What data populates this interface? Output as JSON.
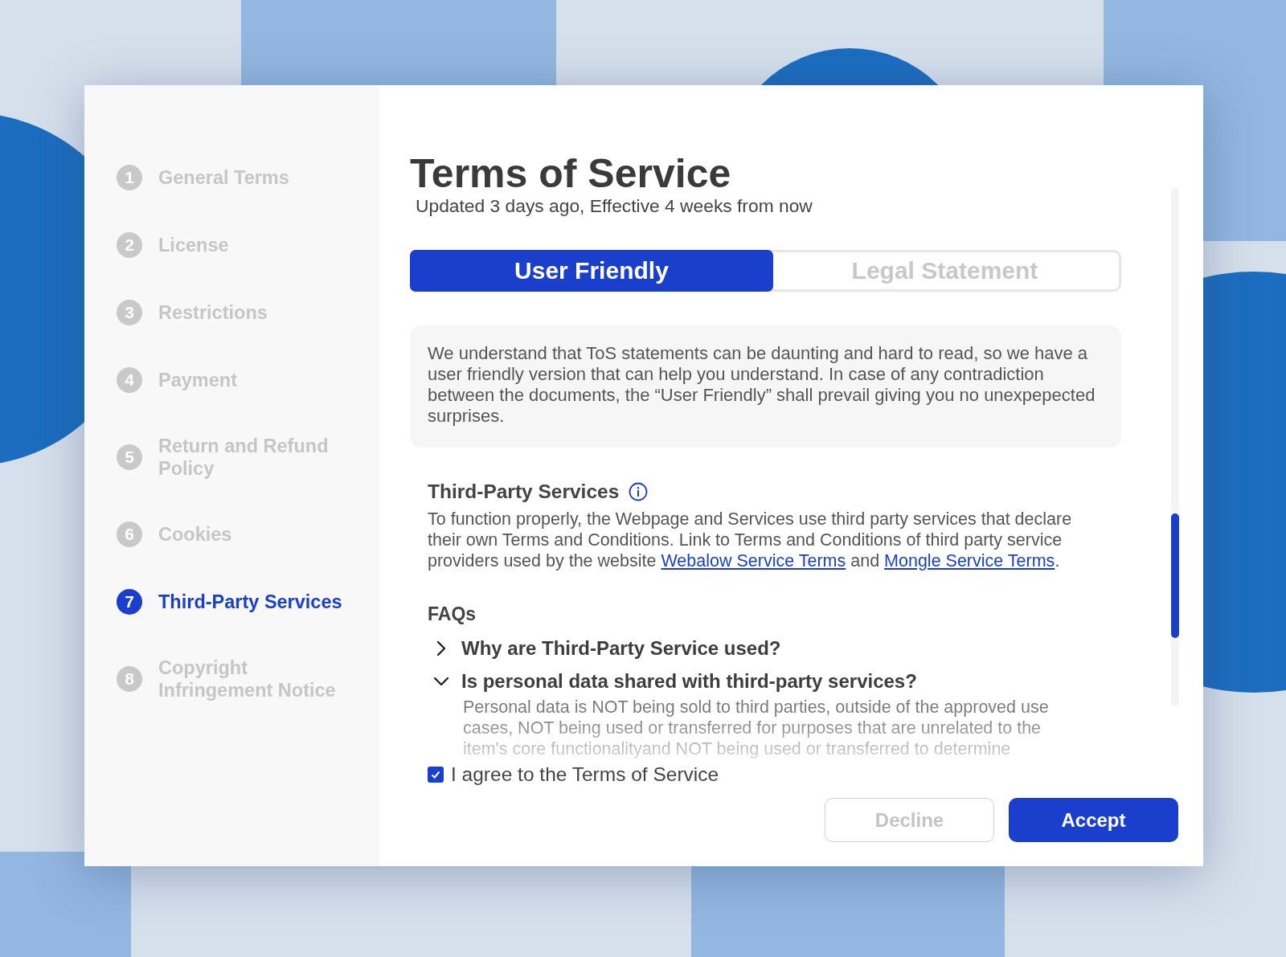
{
  "sidebar": {
    "items": [
      {
        "number": "1",
        "label": "General Terms",
        "selected": false
      },
      {
        "number": "2",
        "label": "License",
        "selected": false
      },
      {
        "number": "3",
        "label": "Restrictions",
        "selected": false
      },
      {
        "number": "4",
        "label": "Payment",
        "selected": false
      },
      {
        "number": "5",
        "label": "Return and Refund Policy",
        "selected": false
      },
      {
        "number": "6",
        "label": "Cookies",
        "selected": false
      },
      {
        "number": "7",
        "label": "Third-Party Services",
        "selected": true
      },
      {
        "number": "8",
        "label": "Copyright Infringement Notice",
        "selected": false
      }
    ]
  },
  "title": "Terms of Service",
  "subtitle": "Updated 3 days ago, Effective 4 weeks from now",
  "tabs": [
    {
      "label": "User Friendly",
      "selected": true
    },
    {
      "label": "Legal Statement",
      "selected": false
    }
  ],
  "notice": "We understand that ToS statements can be daunting and hard to read, so we have a user friendly version that can help you understand. In case of any contradiction between the documents, the “User Friendly” shall prevail giving you no unexpepected surprises.",
  "section": {
    "heading": "Third-Party Services",
    "body": [
      {
        "kind": "text",
        "text": "To function properly, the Webpage and Services use third party services that declare their own Terms and Conditions. Link to Terms and Conditions of third party service providers used by the website "
      },
      {
        "kind": "link",
        "text": "Webalow Service Terms"
      },
      {
        "kind": "text",
        "text": " and "
      },
      {
        "kind": "link",
        "text": "Mongle Service Terms"
      },
      {
        "kind": "text",
        "text": "."
      }
    ]
  },
  "faqs": {
    "heading": "FAQs",
    "items": [
      {
        "question": "Why are Third-Party Service used?",
        "expanded": false
      },
      {
        "question": "Is personal data shared with third-party services?",
        "expanded": true,
        "answer": "Personal data is NOT being sold to third parties, outside of the approved use cases, NOT being used or transferred for purposes that are unrelated to the item's core functionalityand NOT being used or transferred to determine"
      }
    ]
  },
  "agree": {
    "label": "I agree to the Terms of Service",
    "checked": true
  },
  "buttons": [
    {
      "label": "Decline",
      "kind": "secondary"
    },
    {
      "label": "Accept",
      "kind": "primary"
    }
  ]
}
